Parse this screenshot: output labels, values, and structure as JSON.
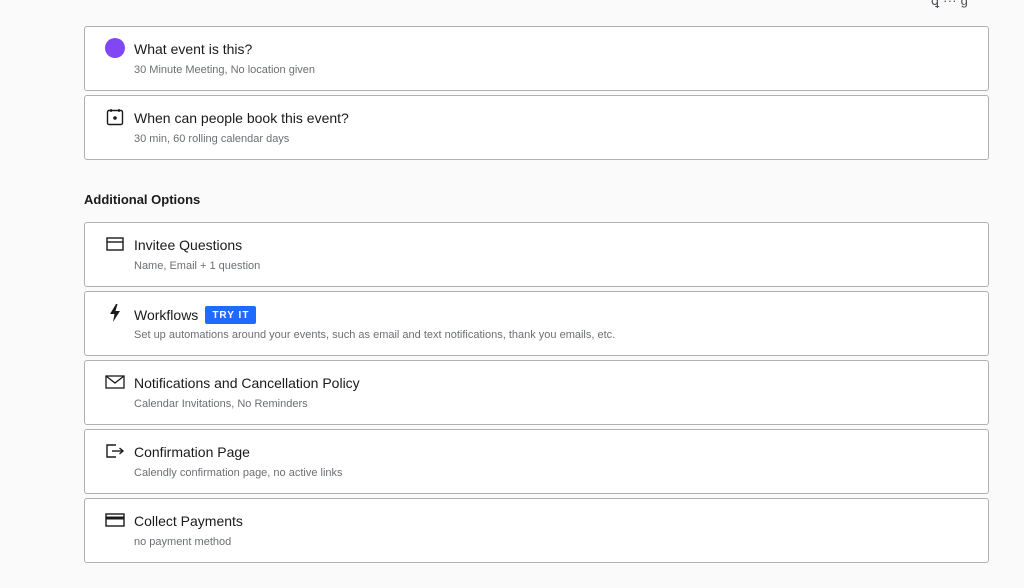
{
  "top_partial_text": "ꝗ ··· g",
  "main_panels": [
    {
      "title": "What event is this?",
      "subtitle": "30 Minute Meeting, No location given",
      "icon": "purple-dot-icon",
      "accent": "#8247f5"
    },
    {
      "title": "When can people book this event?",
      "subtitle": "30 min, 60 rolling calendar days",
      "icon": "calendar-icon"
    }
  ],
  "additional_options": {
    "heading": "Additional Options",
    "items": [
      {
        "title": "Invitee Questions",
        "subtitle": "Name, Email + 1 question",
        "icon": "form-icon"
      },
      {
        "title": "Workflows",
        "badge": "TRY IT",
        "subtitle": "Set up automations around your events, such as email and text notifications, thank you emails, etc.",
        "icon": "lightning-icon",
        "badge_color": "#1f6bff"
      },
      {
        "title": "Notifications and Cancellation Policy",
        "subtitle": "Calendar Invitations, No Reminders",
        "icon": "envelope-icon"
      },
      {
        "title": "Confirmation Page",
        "subtitle": "Calendly confirmation page, no active links",
        "icon": "exit-arrow-icon"
      },
      {
        "title": "Collect Payments",
        "subtitle": "no payment method",
        "icon": "credit-card-icon"
      }
    ]
  }
}
